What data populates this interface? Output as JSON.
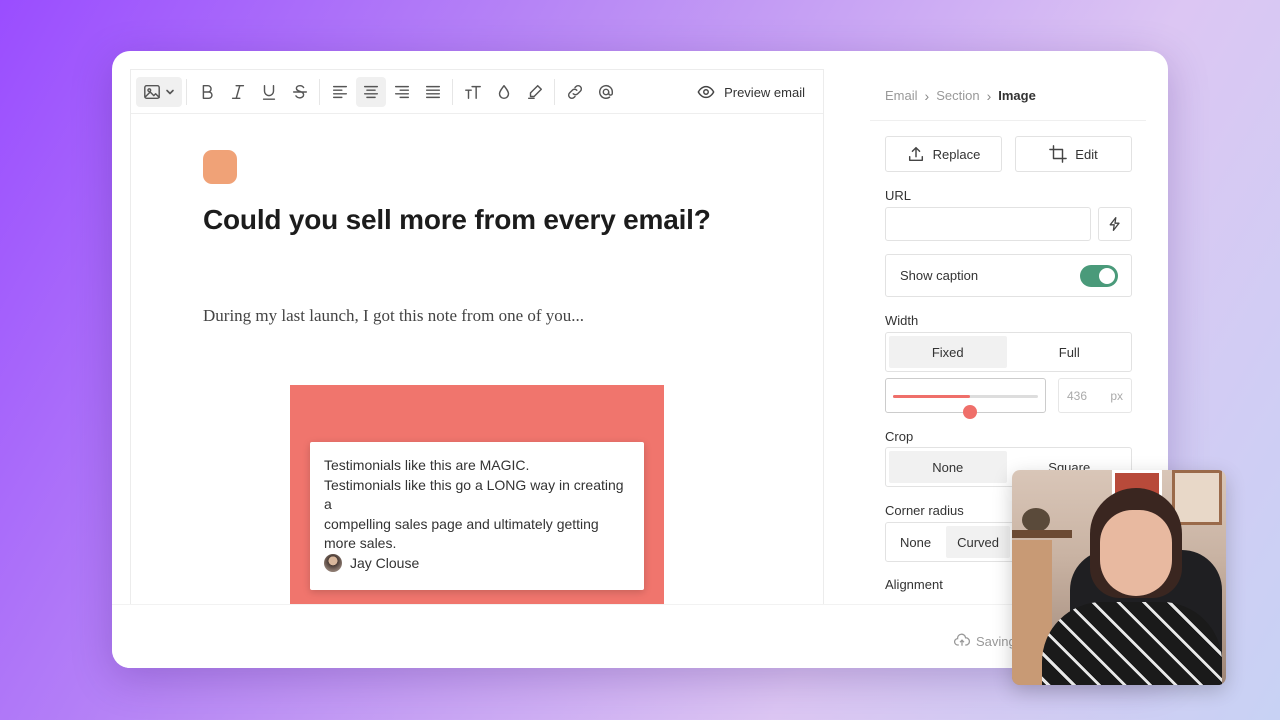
{
  "editor": {
    "toolbar": {
      "icons": [
        "image-icon",
        "chevron-down-icon",
        "bold-icon",
        "italic-icon",
        "underline-icon",
        "strikethrough-icon",
        "align-left-icon",
        "align-center-icon",
        "align-right-icon",
        "align-justify-icon",
        "text-size-icon",
        "color-drop-icon",
        "highlighter-icon",
        "link-icon",
        "at-mention-icon"
      ],
      "active_tool": "align-center",
      "preview_label": "Preview email"
    },
    "headline": "Could you sell more from every email?",
    "lead": "During my last launch, I got this note from one of you...",
    "image_block": {
      "background_color": "#f0756d",
      "testimonial_lines": [
        "Testimonials like this are MAGIC.",
        "Testimonials like this go a LONG way in creating a",
        "compelling sales page and ultimately getting",
        "more sales."
      ],
      "author": "Jay Clouse"
    },
    "status": "Saving"
  },
  "panel": {
    "breadcrumb": [
      "Email",
      "Section",
      "Image"
    ],
    "replace_label": "Replace",
    "edit_label": "Edit",
    "url_label": "URL",
    "url_value": "",
    "show_caption_label": "Show caption",
    "show_caption_on": true,
    "width_label": "Width",
    "width_options": [
      "Fixed",
      "Full"
    ],
    "width_selected": "Fixed",
    "width_slider_fraction": 0.53,
    "width_value": "436",
    "width_unit": "px",
    "crop_label": "Crop",
    "crop_options": [
      "None",
      "Square"
    ],
    "crop_selected": "None",
    "corner_radius_label": "Corner radius",
    "corner_radius_options": [
      "None",
      "Curved"
    ],
    "corner_radius_selected": "Curved",
    "alignment_label": "Alignment"
  },
  "colors": {
    "accent": "#ef6f6a",
    "toggle_on": "#4a9a7a",
    "avatar_square": "#f0a277"
  }
}
